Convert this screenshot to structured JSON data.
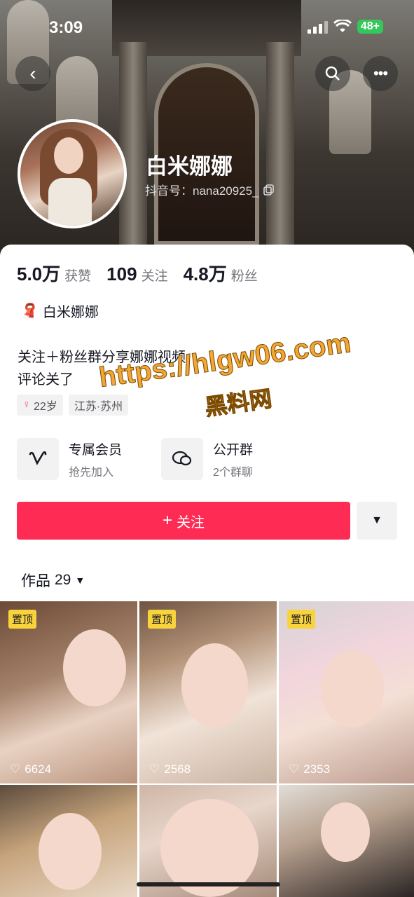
{
  "status_bar": {
    "time": "3:09",
    "battery": "48+"
  },
  "profile": {
    "name": "白米娜娜",
    "douyin_id": "抖音号：nana20925_",
    "stats": [
      {
        "num": "5.0万",
        "label": "获赞"
      },
      {
        "num": "109",
        "label": "关注"
      },
      {
        "num": "4.8万",
        "label": "粉丝"
      }
    ],
    "signature_name": "白米娜娜",
    "bio_line1": "关注＋粉丝群分享娜娜视频",
    "bio_line2": "评论关了",
    "tags": [
      "22岁",
      "江苏·苏州"
    ]
  },
  "features": [
    {
      "title": "专属会员",
      "sub": "抢先加入",
      "icon": "vip-v-icon"
    },
    {
      "title": "公开群",
      "sub": "2个群聊",
      "icon": "group-chat-icon"
    }
  ],
  "actions": {
    "follow": "关注",
    "follow_plus": "+"
  },
  "works": {
    "label": "作品",
    "count": "29"
  },
  "videos": [
    {
      "pinned": "置顶",
      "likes": "6624"
    },
    {
      "pinned": "置顶",
      "likes": "2568"
    },
    {
      "pinned": "置顶",
      "likes": "2353"
    },
    {
      "pinned": "",
      "likes": ""
    },
    {
      "pinned": "",
      "likes": ""
    },
    {
      "pinned": "",
      "likes": ""
    }
  ],
  "watermark": {
    "url": "https://hlgw06.com",
    "site": "黑料网"
  },
  "colors": {
    "accent": "#fe2c55",
    "pin": "#f8d33c",
    "battery": "#34c759"
  }
}
